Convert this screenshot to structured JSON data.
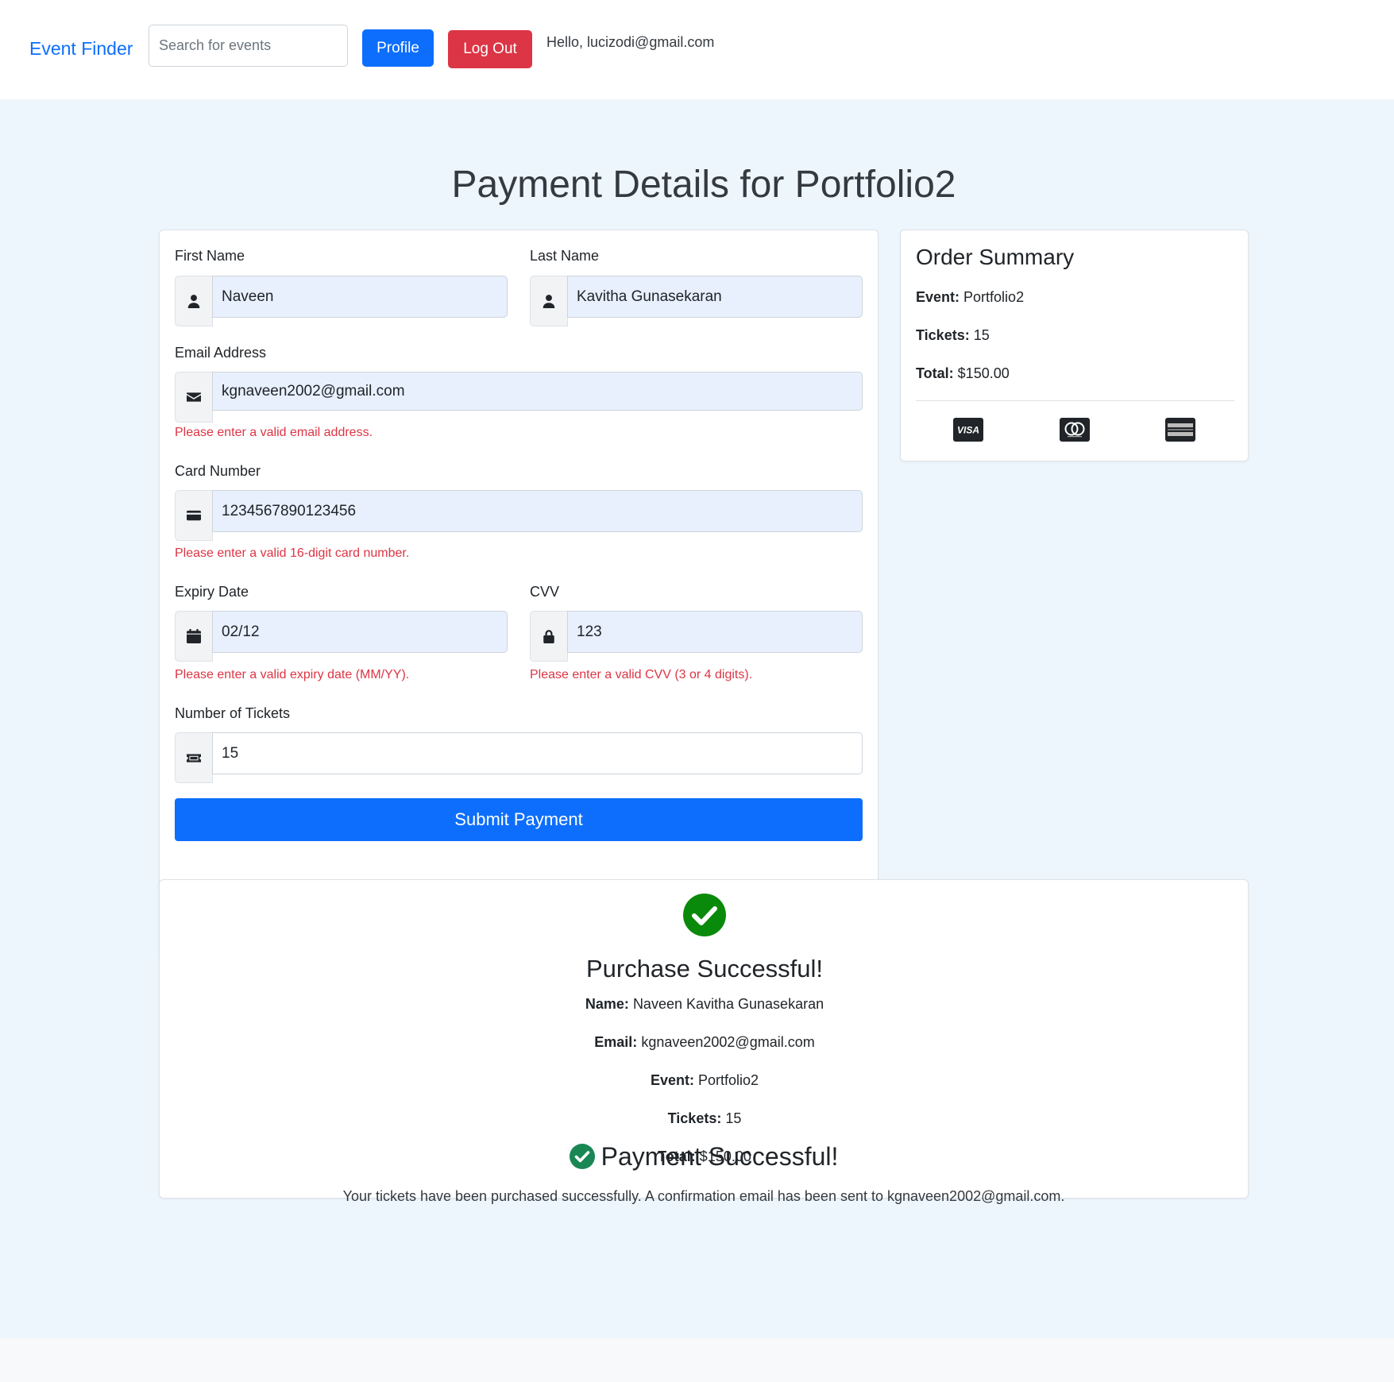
{
  "navbar": {
    "brand": "Event Finder",
    "search_placeholder": "Search for events",
    "profile_label": "Profile",
    "logout_label": "Log Out",
    "greeting": "Hello, lucizodi@gmail.com"
  },
  "page": {
    "title": "Payment Details for Portfolio2"
  },
  "form": {
    "first_name": {
      "label": "First Name",
      "value": "Naveen",
      "icon": "user-icon"
    },
    "last_name": {
      "label": "Last Name",
      "value": "Kavitha Gunasekaran",
      "icon": "user-icon"
    },
    "email": {
      "label": "Email Address",
      "value": "kgnaveen2002@gmail.com",
      "icon": "envelope-icon",
      "error": "Please enter a valid email address."
    },
    "card_number": {
      "label": "Card Number",
      "value": "1234567890123456",
      "icon": "credit-card-icon",
      "error": "Please enter a valid 16-digit card number."
    },
    "expiry": {
      "label": "Expiry Date",
      "value": "02/12",
      "icon": "calendar-icon",
      "error": "Please enter a valid expiry date (MM/YY)."
    },
    "cvv": {
      "label": "CVV",
      "value": "123",
      "icon": "lock-icon",
      "error": "Please enter a valid CVV (3 or 4 digits)."
    },
    "tickets": {
      "label": "Number of Tickets",
      "value": "15",
      "icon": "ticket-icon"
    },
    "submit_label": "Submit Payment"
  },
  "summary": {
    "title": "Order Summary",
    "event_label": "Event:",
    "event_value": "Portfolio2",
    "tickets_label": "Tickets:",
    "tickets_value": "15",
    "total_label": "Total:",
    "total_value": "$150.00",
    "card_icons": [
      "visa-icon",
      "mastercard-icon",
      "amex-icon"
    ]
  },
  "purchase": {
    "title": "Purchase Successful!",
    "name_label": "Name:",
    "name_value": "Naveen Kavitha Gunasekaran",
    "email_label": "Email:",
    "email_value": "kgnaveen2002@gmail.com",
    "event_label": "Event:",
    "event_value": "Portfolio2",
    "tickets_label": "Tickets:",
    "tickets_value": "15",
    "total_label": "Total:",
    "total_value": "$150.00"
  },
  "payment_status": {
    "title": "Payment Successful!",
    "message": "Your tickets have been purchased successfully. A confirmation email has been sent to kgnaveen2002@gmail.com."
  },
  "colors": {
    "primary": "#0d6efd",
    "danger": "#dc3545",
    "success": "#198754",
    "background": "#eef6fd",
    "autofill": "#e8f0fe"
  }
}
